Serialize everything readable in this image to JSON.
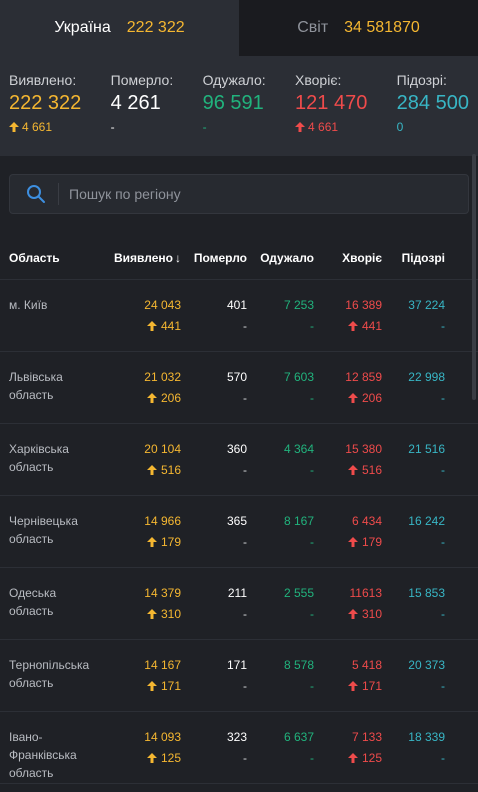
{
  "tabs": [
    {
      "label": "Україна",
      "value": "222 322"
    },
    {
      "label": "Світ",
      "value": "34 581870"
    }
  ],
  "stats": [
    {
      "label": "Виявлено:",
      "value": "222 322",
      "delta": "4 661",
      "delta_up": true
    },
    {
      "label": "Померло:",
      "value": "4 261",
      "delta": "-",
      "delta_up": false
    },
    {
      "label": "Одужало:",
      "value": "96 591",
      "delta": "-",
      "delta_up": false
    },
    {
      "label": "Хворіє:",
      "value": "121 470",
      "delta": "4 661",
      "delta_up": true
    },
    {
      "label": "Підозрі:",
      "value": "284 500",
      "delta": "0",
      "delta_up": false
    }
  ],
  "search": {
    "placeholder": "Пошук по регіону"
  },
  "table": {
    "headers": {
      "region": "Область",
      "cases": "Виявлено",
      "sort_icon": "↓",
      "deaths": "Померло",
      "recovered": "Одужало",
      "sick": "Хворіє",
      "suspected": "Підозрі"
    },
    "rows": [
      {
        "region": "м. Київ",
        "cases": "24 043",
        "cases_delta": "441",
        "deaths": "401",
        "deaths_delta": "-",
        "recovered": "7 253",
        "recovered_delta": "-",
        "sick": "16 389",
        "sick_delta": "441",
        "suspected": "37 224",
        "suspected_delta": "-"
      },
      {
        "region": "Львівська область",
        "cases": "21 032",
        "cases_delta": "206",
        "deaths": "570",
        "deaths_delta": "-",
        "recovered": "7 603",
        "recovered_delta": "-",
        "sick": "12 859",
        "sick_delta": "206",
        "suspected": "22 998",
        "suspected_delta": "-"
      },
      {
        "region": "Харківська область",
        "cases": "20 104",
        "cases_delta": "516",
        "deaths": "360",
        "deaths_delta": "-",
        "recovered": "4 364",
        "recovered_delta": "-",
        "sick": "15 380",
        "sick_delta": "516",
        "suspected": "21 516",
        "suspected_delta": "-"
      },
      {
        "region": "Чернівецька область",
        "cases": "14 966",
        "cases_delta": "179",
        "deaths": "365",
        "deaths_delta": "-",
        "recovered": "8 167",
        "recovered_delta": "-",
        "sick": "6 434",
        "sick_delta": "179",
        "suspected": "16 242",
        "suspected_delta": "-"
      },
      {
        "region": "Одеська область",
        "cases": "14 379",
        "cases_delta": "310",
        "deaths": "211",
        "deaths_delta": "-",
        "recovered": "2 555",
        "recovered_delta": "-",
        "sick": "11613",
        "sick_delta": "310",
        "suspected": "15 853",
        "suspected_delta": "-"
      },
      {
        "region": "Тернопільська область",
        "cases": "14 167",
        "cases_delta": "171",
        "deaths": "171",
        "deaths_delta": "-",
        "recovered": "8 578",
        "recovered_delta": "-",
        "sick": "5 418",
        "sick_delta": "171",
        "suspected": "20 373",
        "suspected_delta": "-"
      },
      {
        "region": "Івано-Франківська область",
        "cases": "14 093",
        "cases_delta": "125",
        "deaths": "323",
        "deaths_delta": "-",
        "recovered": "6 637",
        "recovered_delta": "-",
        "sick": "7 133",
        "sick_delta": "125",
        "suspected": "18 339",
        "suspected_delta": "-"
      }
    ]
  },
  "colors": {
    "yellow": "#f5b731",
    "green": "#21b37d",
    "red": "#ef4b4b",
    "teal": "#38b6c5",
    "background": "#1f2126"
  },
  "icons": {
    "search": "search-icon",
    "up_arrow": "arrow-up-icon"
  }
}
